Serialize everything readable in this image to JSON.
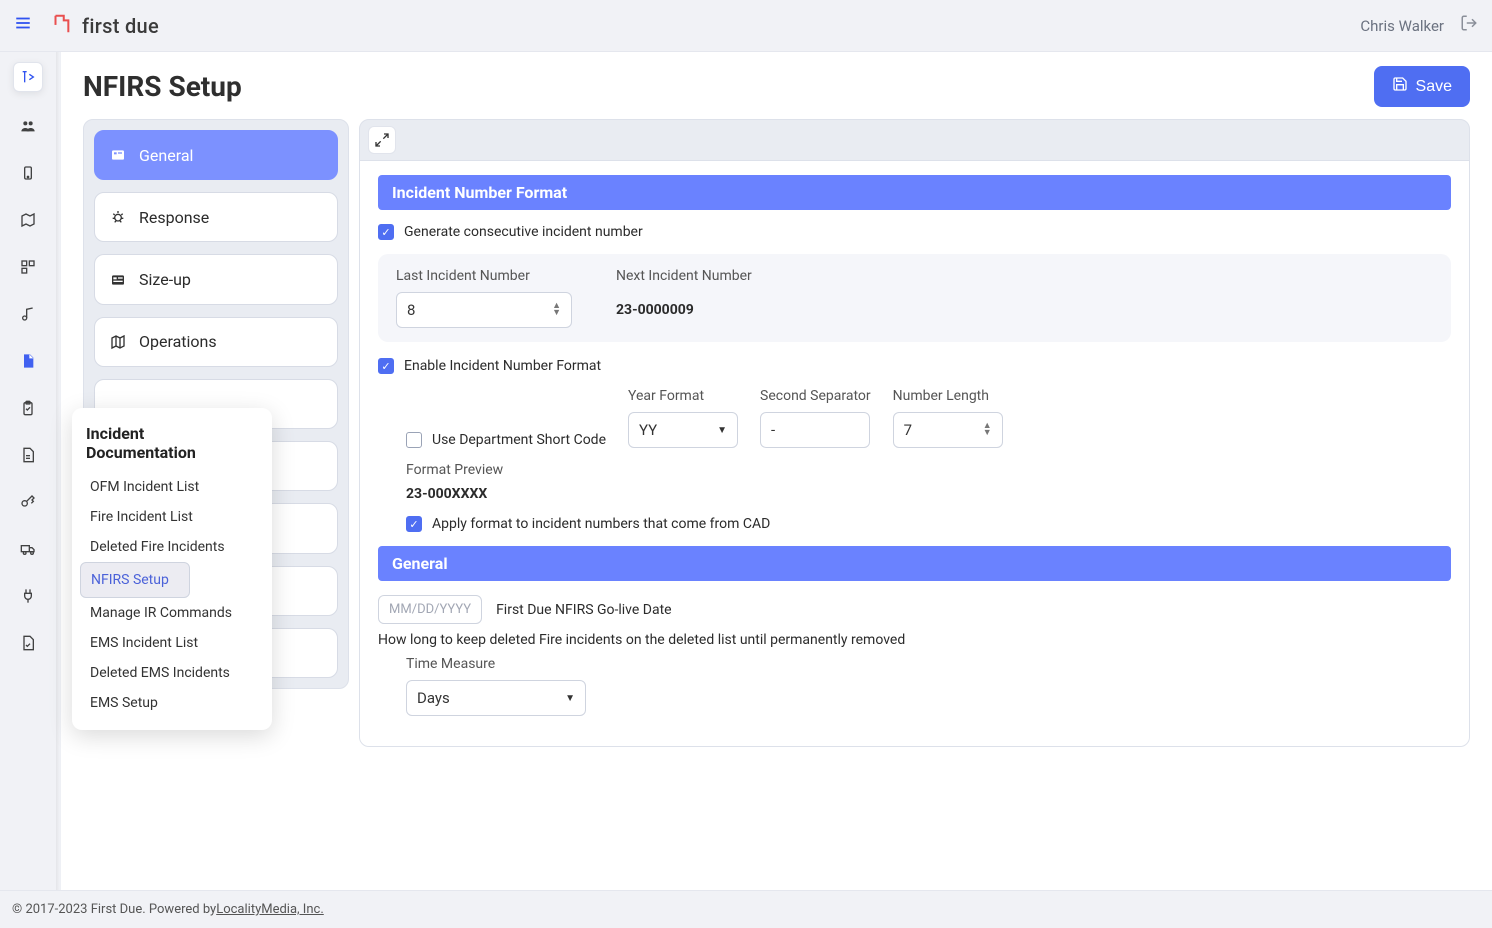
{
  "header": {
    "brand": "first due",
    "user": "Chris Walker"
  },
  "page": {
    "title": "NFIRS Setup",
    "save_label": "Save"
  },
  "left_nav": {
    "items": [
      {
        "icon": "general",
        "label": "General",
        "active": true
      },
      {
        "icon": "bug",
        "label": "Response"
      },
      {
        "icon": "layout",
        "label": "Size-up"
      },
      {
        "icon": "map",
        "label": "Operations"
      },
      {
        "icon": "",
        "label": ""
      },
      {
        "icon": "",
        "label": ""
      },
      {
        "icon": "",
        "label": ""
      },
      {
        "icon": "",
        "label": ""
      },
      {
        "icon": "",
        "label": ""
      }
    ]
  },
  "rail_icons": [
    "expand-right",
    "users",
    "device",
    "map-outline",
    "apps",
    "music",
    "document",
    "clipboard",
    "file-text",
    "key",
    "truck",
    "plug",
    "file-check"
  ],
  "flyout": {
    "title": "Incident Documentation",
    "items": [
      {
        "label": "OFM Incident List"
      },
      {
        "label": "Fire Incident List"
      },
      {
        "label": "Deleted Fire Incidents"
      },
      {
        "label": "NFIRS Setup",
        "selected": true
      },
      {
        "label": "Manage IR Commands"
      },
      {
        "label": "EMS Incident List"
      },
      {
        "label": "Deleted EMS Incidents"
      },
      {
        "label": "EMS Setup"
      }
    ]
  },
  "form": {
    "section1_title": "Incident Number Format",
    "gen_consecutive_label": "Generate consecutive incident number",
    "gen_consecutive_checked": true,
    "last_label": "Last Incident Number",
    "last_value": "8",
    "next_label": "Next Incident Number",
    "next_value": "23-0000009",
    "enable_format_label": "Enable Incident Number Format",
    "enable_format_checked": true,
    "use_dept_short_label": "Use Department Short Code",
    "use_dept_short_checked": false,
    "year_format_label": "Year Format",
    "year_format_value": "YY",
    "second_sep_label": "Second Separator",
    "second_sep_value": "-",
    "number_length_label": "Number Length",
    "number_length_value": "7",
    "format_preview_label": "Format Preview",
    "format_preview_value": "23-000XXXX",
    "apply_cad_label": "Apply format to incident numbers that come from CAD",
    "apply_cad_checked": true,
    "section2_title": "General",
    "go_live_placeholder": "MM/DD/YYYY",
    "go_live_label": "First Due NFIRS Go-live Date",
    "keep_deleted_label": "How long to keep deleted Fire incidents on the deleted list until permanently removed",
    "time_measure_label": "Time Measure",
    "time_measure_value": "Days"
  },
  "footer": {
    "copyright": "© 2017-2023 First Due. Powered by ",
    "link": "LocalityMedia, Inc."
  }
}
